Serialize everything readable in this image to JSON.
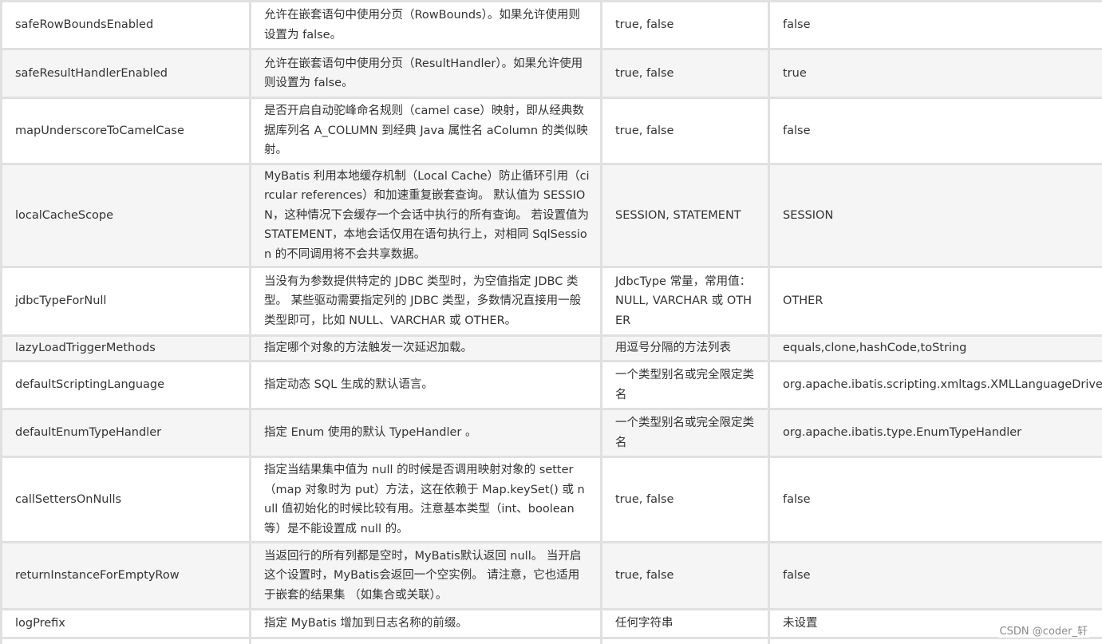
{
  "rows": [
    {
      "name": "safeRowBoundsEnabled",
      "desc": "允许在嵌套语句中使用分页（RowBounds）。如果允许使用则设置为 false。",
      "values": "true, false",
      "default": "false"
    },
    {
      "name": "safeResultHandlerEnabled",
      "desc": "允许在嵌套语句中使用分页（ResultHandler）。如果允许使用则设置为 false。",
      "values": "true, false",
      "default": "true"
    },
    {
      "name": "mapUnderscoreToCamelCase",
      "desc": "是否开启自动驼峰命名规则（camel case）映射，即从经典数据库列名 A_COLUMN 到经典 Java 属性名 aColumn 的类似映射。",
      "values": "true, false",
      "default": "false"
    },
    {
      "name": "localCacheScope",
      "desc": "MyBatis 利用本地缓存机制（Local Cache）防止循环引用（circular references）和加速重复嵌套查询。 默认值为 SESSION，这种情况下会缓存一个会话中执行的所有查询。 若设置值为 STATEMENT，本地会话仅用在语句执行上，对相同 SqlSession 的不同调用将不会共享数据。",
      "values": "SESSION, STATEMENT",
      "default": "SESSION"
    },
    {
      "name": "jdbcTypeForNull",
      "desc": "当没有为参数提供特定的 JDBC 类型时，为空值指定 JDBC 类型。 某些驱动需要指定列的 JDBC 类型，多数情况直接用一般类型即可，比如 NULL、VARCHAR 或 OTHER。",
      "values": "JdbcType 常量，常用值：NULL, VARCHAR 或 OTHER",
      "default": "OTHER"
    },
    {
      "name": "lazyLoadTriggerMethods",
      "desc": "指定哪个对象的方法触发一次延迟加载。",
      "values": "用逗号分隔的方法列表",
      "default": "equals,clone,hashCode,toString"
    },
    {
      "name": "defaultScriptingLanguage",
      "desc": "指定动态 SQL 生成的默认语言。",
      "values": "一个类型别名或完全限定类名",
      "default": "org.apache.ibatis.scripting.xmltags.XMLLanguageDriver"
    },
    {
      "name": "defaultEnumTypeHandler",
      "desc": "指定 Enum 使用的默认 TypeHandler 。",
      "values": "一个类型别名或完全限定类名",
      "default": "org.apache.ibatis.type.EnumTypeHandler"
    },
    {
      "name": "callSettersOnNulls",
      "desc": "指定当结果集中值为 null 的时候是否调用映射对象的 setter（map 对象时为 put）方法，这在依赖于 Map.keySet() 或 null 值初始化的时候比较有用。注意基本类型（int、boolean 等）是不能设置成 null 的。",
      "values": "true, false",
      "default": "false"
    },
    {
      "name": "returnInstanceForEmptyRow",
      "desc": "当返回行的所有列都是空时，MyBatis默认返回 null。 当开启这个设置时，MyBatis会返回一个空实例。 请注意，它也适用于嵌套的结果集 （如集合或关联）。",
      "values": "true, false",
      "default": "false"
    },
    {
      "name": "logPrefix",
      "desc": "指定 MyBatis 增加到日志名称的前缀。",
      "values": "任何字符串",
      "default": "未设置"
    }
  ],
  "watermark": "CSDN @coder_轩"
}
